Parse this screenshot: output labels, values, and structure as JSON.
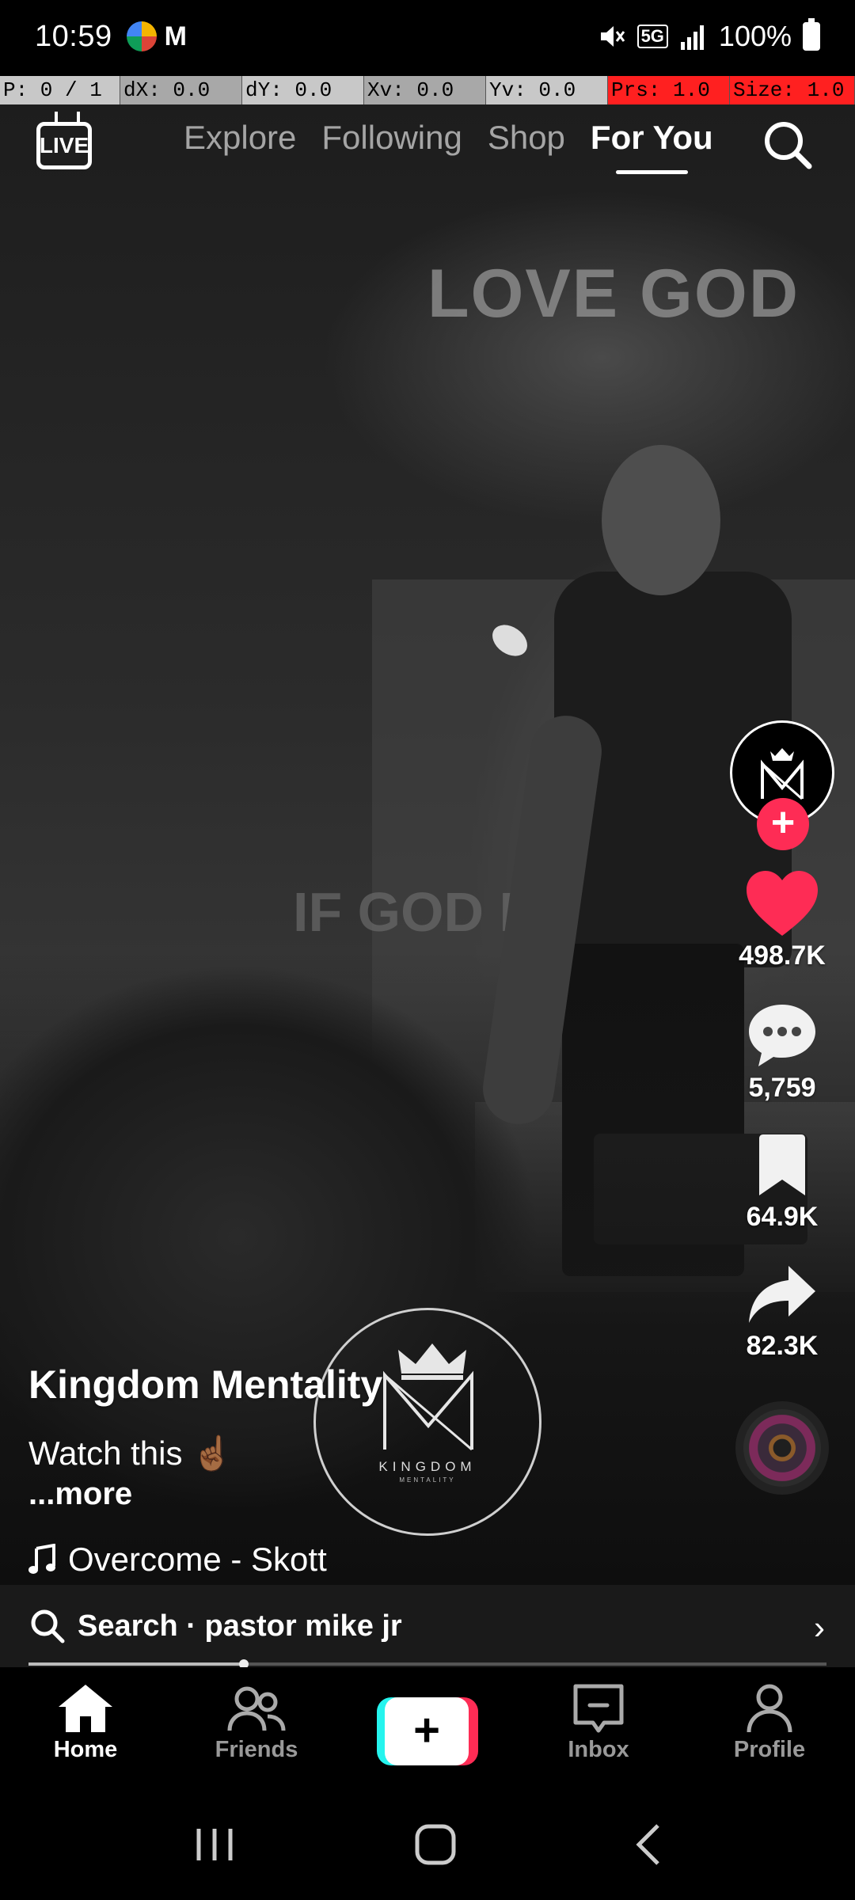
{
  "status_bar": {
    "time": "10:59",
    "network": "5G",
    "battery": "100%"
  },
  "pointer_overlay": {
    "p": "P: 0 / 1",
    "dx": "dX: 0.0",
    "dy": "dY: 0.0",
    "xv": "Xv: 0.0",
    "yv": "Yv: 0.0",
    "prs": "Prs: 1.0",
    "size": "Size: 1.0"
  },
  "top_nav": {
    "live_label": "LIVE",
    "tabs": [
      {
        "label": "Explore",
        "active": false
      },
      {
        "label": "Following",
        "active": false
      },
      {
        "label": "Shop",
        "active": false
      },
      {
        "label": "For You",
        "active": true
      }
    ]
  },
  "video": {
    "backdrop_text": "LOVE GOD",
    "backdrop_text_2": "IF GOD KEPT"
  },
  "actions": {
    "likes": "498.7K",
    "comments": "5,759",
    "saves": "64.9K",
    "shares": "82.3K"
  },
  "post": {
    "author": "Kingdom Mentality",
    "description": "Watch this ☝🏾",
    "more_label": "...more",
    "sound": "Overcome - Skott",
    "progress": 0.27
  },
  "watermark": {
    "text": "KINGDOM",
    "subtext": "MENTALITY"
  },
  "search_bar": {
    "text": "Search · pastor mike jr"
  },
  "tab_bar": {
    "items": [
      {
        "label": "Home",
        "active": true
      },
      {
        "label": "Friends",
        "active": false
      },
      {
        "label": "Inbox",
        "active": false
      },
      {
        "label": "Profile",
        "active": false
      }
    ]
  },
  "colors": {
    "accent": "#fe2c55",
    "cyan": "#25f4ee",
    "like": "#fe2c55"
  }
}
